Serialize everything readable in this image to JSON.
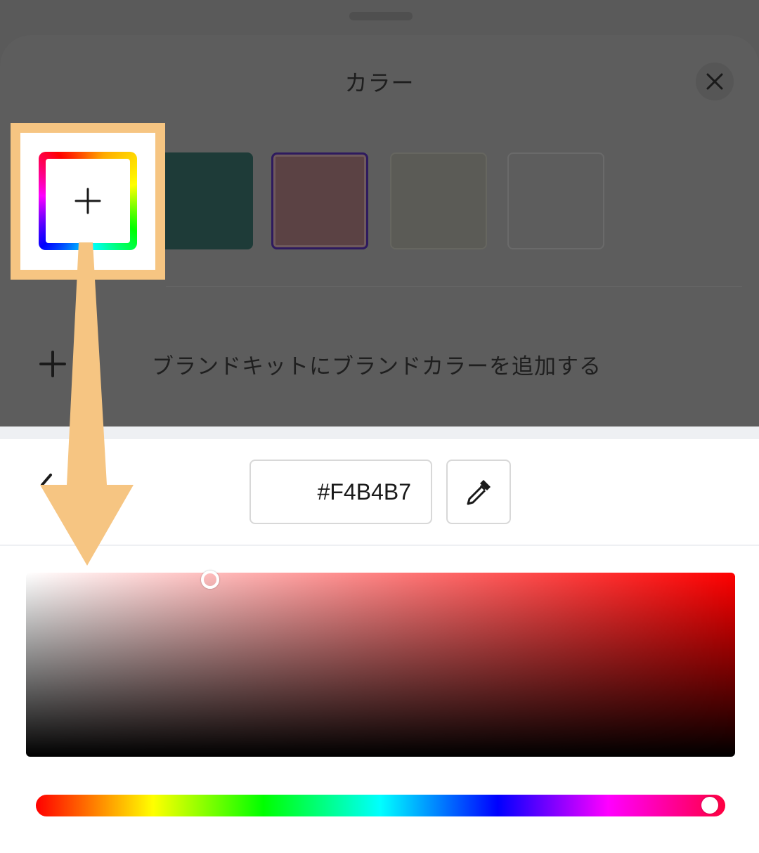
{
  "sheet": {
    "title": "カラー",
    "close_icon": "close-icon",
    "add_brand_label": "ブランドキットにブランドカラーを追加する",
    "swatches": [
      {
        "color": "#1e3b38"
      },
      {
        "color": "#5b4244",
        "selected": true
      },
      {
        "color": "#5b5b56"
      },
      {
        "color": "#5d5d5d"
      }
    ]
  },
  "custom_color_button": {
    "icon": "plus-icon"
  },
  "picker": {
    "hex_value": "#F4B4B7",
    "eyedropper_icon": "eyedropper-icon",
    "back_icon": "chevron-left-icon",
    "hue_level": 0.98
  },
  "colors": {
    "highlight": "#f6c582",
    "backdrop": "#5a5a5a"
  }
}
